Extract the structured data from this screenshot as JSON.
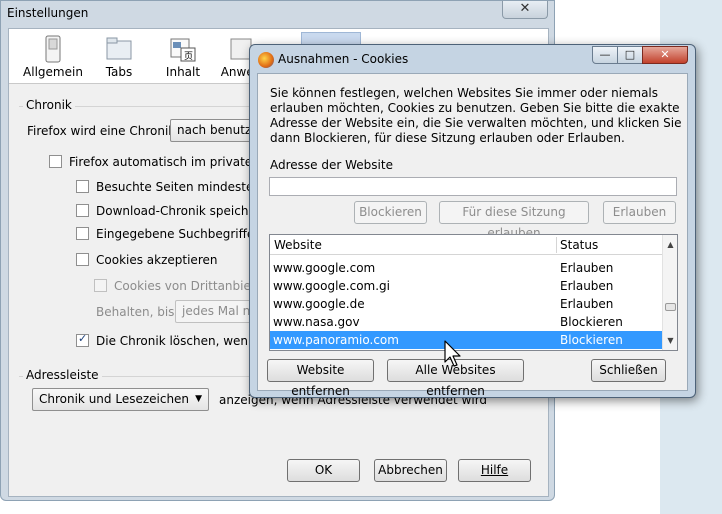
{
  "main_window": {
    "title": "Einstellungen",
    "close_glyph": "✕",
    "toolbar": [
      {
        "label": "Allgemein",
        "icon": "switch-icon"
      },
      {
        "label": "Tabs",
        "icon": "folder-icon"
      },
      {
        "label": "Inhalt",
        "icon": "content-icon"
      },
      {
        "label": "Anwen",
        "icon": "applications-icon"
      }
    ],
    "chronik": {
      "group_label": "Chronik",
      "will_label": "Firefox wird eine Chronik:",
      "will_value": "nach benutzer",
      "private_mode": "Firefox automatisch im privaten M",
      "remember_visits": "Besuchte Seiten mindestens",
      "download_history": "Download-Chronik speichern",
      "search_terms": "Eingegebene Suchbegriffe un",
      "accept_cookies": "Cookies akzeptieren",
      "third_party": "Cookies von Drittanbieter",
      "keep_label": "Behalten, bis:",
      "keep_value": "jedes Mal na",
      "clear_on_close": "Die Chronik löschen, wenn Fi"
    },
    "adressleiste": {
      "group_label": "Adressleiste",
      "select_value": "Chronik und Lesezeichen",
      "suffix_text": "anzeigen, wenn Adressleiste verwendet wird"
    },
    "buttons": {
      "ok": "OK",
      "cancel": "Abbrechen",
      "help": "Hilfe"
    }
  },
  "dialog": {
    "title": "Ausnahmen - Cookies",
    "caption": {
      "minimize": "—",
      "maximize": "□",
      "close": "✕"
    },
    "intro": "Sie können festlegen, welchen Websites Sie immer oder niemals erlauben möchten, Cookies zu benutzen. Geben Sie bitte die exakte Adresse der Website ein, die Sie verwalten möchten, und klicken Sie dann Blockieren, für diese Sitzung erlauben oder Erlauben.",
    "address_label": "Adresse der Website",
    "address_value": "",
    "buttons": {
      "block": "Blockieren",
      "session": "Für diese Sitzung erlauben",
      "allow": "Erlauben",
      "remove": "Website entfernen",
      "remove_all": "Alle Websites entfernen",
      "close": "Schließen"
    },
    "columns": {
      "site": "Website",
      "status": "Status"
    },
    "rows": [
      {
        "site": "www.google.com",
        "status": "Erlauben"
      },
      {
        "site": "www.google.com.gi",
        "status": "Erlauben"
      },
      {
        "site": "www.google.de",
        "status": "Erlauben"
      },
      {
        "site": "www.nasa.gov",
        "status": "Blockieren"
      },
      {
        "site": "www.panoramio.com",
        "status": "Blockieren"
      }
    ]
  }
}
